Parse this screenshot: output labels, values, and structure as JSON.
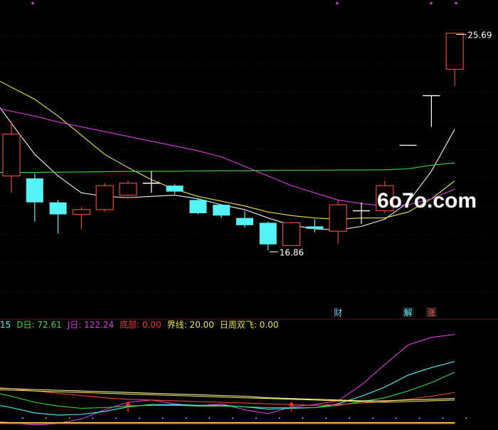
{
  "watermark": "6o7o.com",
  "colors": {
    "background": "#000000",
    "up": "#e8443a",
    "down": "#54f3f6",
    "doji": "#ffffff",
    "ma_white": "#f2f2f2",
    "ma_yellow": "#e9e34a",
    "ma_magenta": "#d83be0",
    "ma_green": "#3ed93e",
    "grid": "#5a1a1a",
    "arrow": "#ff2b2b"
  },
  "chart_data": [
    {
      "type": "candlestick",
      "ylim": [
        14.0,
        26.8
      ],
      "annotations": {
        "high_label": "25.69",
        "low_label": "16.86",
        "markers": [
          {
            "index": 14,
            "text": "财",
            "color": "#7ec8ff"
          },
          {
            "index": 17,
            "text": "解",
            "color": "#54f3f6",
            "box": true
          },
          {
            "index": 18,
            "text": "涨",
            "color": "#ff5a5a",
            "box": true
          }
        ]
      },
      "candles": [
        {
          "open": 19.7,
          "high": 22.0,
          "low": 19.0,
          "close": 21.45
        },
        {
          "open": 19.6,
          "high": 19.8,
          "low": 17.8,
          "close": 18.6
        },
        {
          "open": 18.6,
          "high": 18.7,
          "low": 17.3,
          "close": 18.1
        },
        {
          "open": 18.1,
          "high": 18.4,
          "low": 17.5,
          "close": 18.3
        },
        {
          "open": 18.3,
          "high": 19.4,
          "low": 18.2,
          "close": 19.3
        },
        {
          "open": 18.9,
          "high": 19.5,
          "low": 18.85,
          "close": 19.4
        },
        {
          "open": 19.4,
          "high": 19.9,
          "low": 19.0,
          "close": 19.4
        },
        {
          "open": 19.3,
          "high": 19.35,
          "low": 18.95,
          "close": 19.05
        },
        {
          "open": 18.7,
          "high": 18.75,
          "low": 18.1,
          "close": 18.15
        },
        {
          "open": 18.5,
          "high": 18.5,
          "low": 17.95,
          "close": 18.05
        },
        {
          "open": 17.95,
          "high": 18.25,
          "low": 17.55,
          "close": 17.65
        },
        {
          "open": 17.75,
          "high": 17.8,
          "low": 16.6,
          "close": 16.85
        },
        {
          "open": 16.8,
          "high": 17.8,
          "low": 16.8,
          "close": 17.75
        },
        {
          "open": 17.6,
          "high": 17.9,
          "low": 17.35,
          "close": 17.5
        },
        {
          "open": 17.4,
          "high": 18.7,
          "low": 16.86,
          "close": 18.5
        },
        {
          "open": 18.25,
          "high": 18.6,
          "low": 17.7,
          "close": 18.25
        },
        {
          "open": 18.25,
          "high": 19.5,
          "low": 18.15,
          "close": 19.3
        },
        {
          "open": 20.98,
          "high": 20.98,
          "low": 20.98,
          "close": 20.98
        },
        {
          "open": 23.05,
          "high": 23.05,
          "low": 21.75,
          "close": 23.05
        },
        {
          "open": 24.15,
          "high": 25.69,
          "low": 23.45,
          "close": 25.65
        }
      ],
      "moving_averages": [
        {
          "color": "#f2f2f2",
          "values": [
            21.9,
            20.6,
            19.7,
            19.0,
            18.85,
            18.8,
            18.85,
            18.9,
            18.75,
            18.5,
            18.3,
            17.95,
            17.65,
            17.5,
            17.45,
            17.6,
            17.9,
            18.6,
            19.9,
            21.65
          ]
        },
        {
          "color": "#e9e34a",
          "values": [
            23.4,
            22.9,
            22.2,
            21.4,
            20.6,
            20.05,
            19.55,
            19.15,
            18.85,
            18.65,
            18.45,
            18.2,
            18.05,
            17.95,
            17.9,
            17.95,
            17.95,
            18.2,
            18.75,
            19.5
          ]
        },
        {
          "color": "#d83be0",
          "values": [
            22.4,
            22.2,
            21.95,
            21.75,
            21.55,
            21.35,
            21.15,
            20.95,
            20.75,
            20.5,
            20.1,
            19.7,
            19.3,
            19.0,
            18.7,
            18.55,
            18.45,
            18.5,
            18.75,
            19.15
          ]
        },
        {
          "color": "#3ed93e",
          "values": [
            19.85,
            19.85,
            19.86,
            19.87,
            19.88,
            19.89,
            19.9,
            19.9,
            19.91,
            19.92,
            19.92,
            19.93,
            19.94,
            19.94,
            19.95,
            19.95,
            19.96,
            20.0,
            20.15,
            20.25
          ]
        }
      ]
    },
    {
      "type": "line",
      "ylim": [
        0,
        130
      ],
      "legend": [
        {
          "text": "15",
          "color": "#54f3f6"
        },
        {
          "text": "D日: 72.61",
          "color": "#3ed93e"
        },
        {
          "text": "J日: 122.24",
          "color": "#d83be0"
        },
        {
          "text": "底部: 0.00",
          "color": "#ff3030"
        },
        {
          "text": "界线: 20.00",
          "color": "#e9e34a"
        },
        {
          "text": "日周双飞: 0.00",
          "color": "#e9e34a"
        }
      ],
      "signal_arrows": [
        5,
        12
      ],
      "series": [
        {
          "name": "J日",
          "color": "#d83be0",
          "values": [
            5,
            2,
            4,
            10,
            22,
            32,
            35,
            30,
            27,
            30,
            22,
            17,
            26,
            29,
            34,
            55,
            82,
            108,
            118,
            122
          ]
        },
        {
          "color": "#54f3f6",
          "values": [
            25,
            18,
            15,
            16,
            20,
            26,
            29,
            29,
            28,
            28,
            26,
            23,
            24,
            25,
            30,
            40,
            52,
            68,
            78,
            86
          ]
        },
        {
          "color": "#3ed93e",
          "values": [
            40,
            32,
            27,
            24,
            25,
            27,
            28,
            28,
            27,
            27,
            26,
            25,
            25,
            25,
            28,
            33,
            38,
            47,
            58,
            72
          ]
        },
        {
          "color": "#e8443a",
          "values": [
            50,
            47,
            44,
            41,
            38,
            36,
            35,
            34,
            33,
            32,
            31,
            30,
            29,
            28,
            29,
            31,
            33,
            36,
            40,
            45
          ]
        },
        {
          "color": "#f4f0a0",
          "values": [
            50,
            49,
            48,
            47,
            46,
            45,
            44,
            43,
            42,
            41,
            40,
            38,
            37,
            36,
            35,
            34,
            34,
            35,
            36,
            37
          ]
        },
        {
          "color": "#e9e34a",
          "values": [
            48,
            47,
            46,
            45,
            44,
            43,
            42,
            41,
            40,
            39,
            38,
            37,
            36,
            35,
            34,
            33,
            32,
            33,
            34,
            35
          ]
        }
      ],
      "baselines": [
        {
          "color": "#e9e34a",
          "value": 5
        },
        {
          "color": "#ff4fb0",
          "value": 4
        }
      ]
    }
  ]
}
